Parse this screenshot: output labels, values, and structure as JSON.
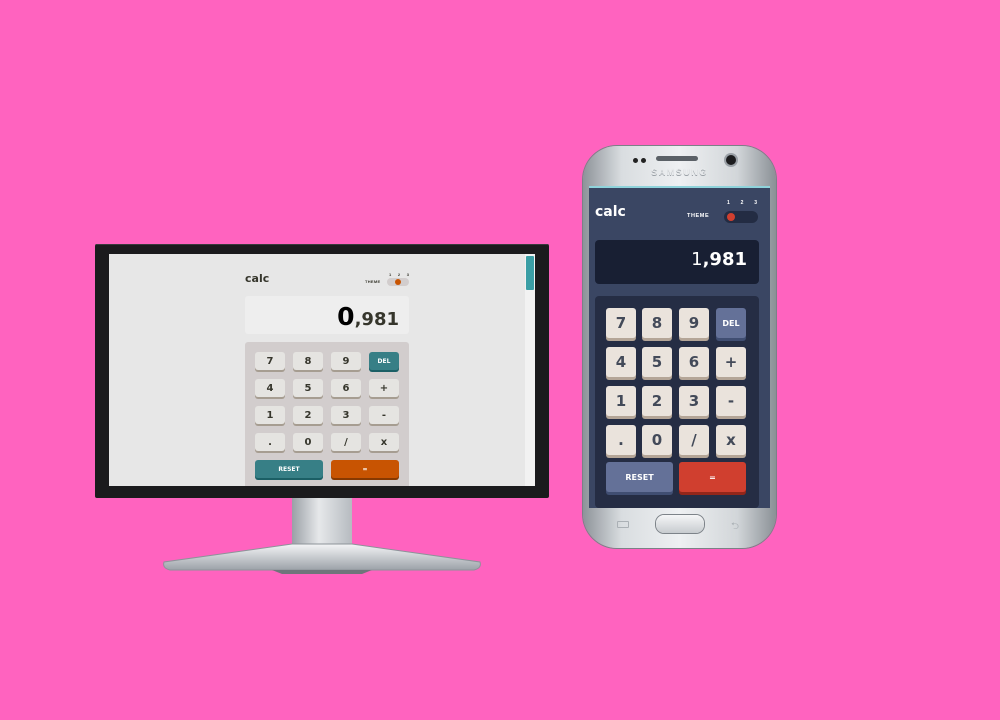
{
  "desktop": {
    "logo": "calc",
    "theme_label": "THEME",
    "theme_numbers": [
      "1",
      "2",
      "3"
    ],
    "active_theme": 2,
    "display": {
      "lead": "0",
      "rest": ",981"
    },
    "keys": {
      "row1": [
        "7",
        "8",
        "9",
        "DEL"
      ],
      "row2": [
        "4",
        "5",
        "6",
        "+"
      ],
      "row3": [
        "1",
        "2",
        "3",
        "-"
      ],
      "row4": [
        ".",
        "0",
        "/",
        "x"
      ],
      "reset": "RESET",
      "equals": "="
    }
  },
  "phone": {
    "brand": "SAMSUNG",
    "logo": "calc",
    "theme_label": "THEME",
    "theme_numbers": [
      "1",
      "2",
      "3"
    ],
    "active_theme": 1,
    "display": {
      "lead": "1",
      "rest": ",981"
    },
    "keys": {
      "row1": [
        "7",
        "8",
        "9",
        "DEL"
      ],
      "row2": [
        "4",
        "5",
        "6",
        "+"
      ],
      "row3": [
        "1",
        "2",
        "3",
        "-"
      ],
      "row4": [
        ".",
        "0",
        "/",
        "x"
      ],
      "reset": "RESET",
      "equals": "="
    }
  },
  "colors": {
    "background": "#ff63bf",
    "desktop_accent": "#377f86",
    "desktop_equals": "#c85402",
    "phone_accent": "#647198",
    "phone_equals": "#d03f2f"
  }
}
